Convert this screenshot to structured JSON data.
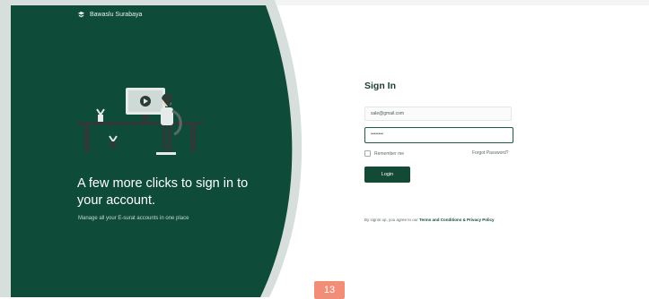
{
  "brand": {
    "name": "Bawaslu Surabaya"
  },
  "hero": {
    "title": "A few more clicks to sign in to your account.",
    "subtitle": "Manage all your E-surat accounts in one place"
  },
  "form": {
    "title": "Sign In",
    "email_value": "sale@gmail.com",
    "password_value": "••••••••",
    "remember_label": "Remember me",
    "forgot_label": "Forgot Password?",
    "login_label": "Login",
    "agree_prefix": "By signin up, you agree to our ",
    "agree_link": "Terms and Conditions & Privacy Policy"
  },
  "overlay": {
    "page_number": "13"
  },
  "colors": {
    "brand_green": "#124a35",
    "hero_green": "#0f4b39",
    "badge": "#f28e77"
  }
}
